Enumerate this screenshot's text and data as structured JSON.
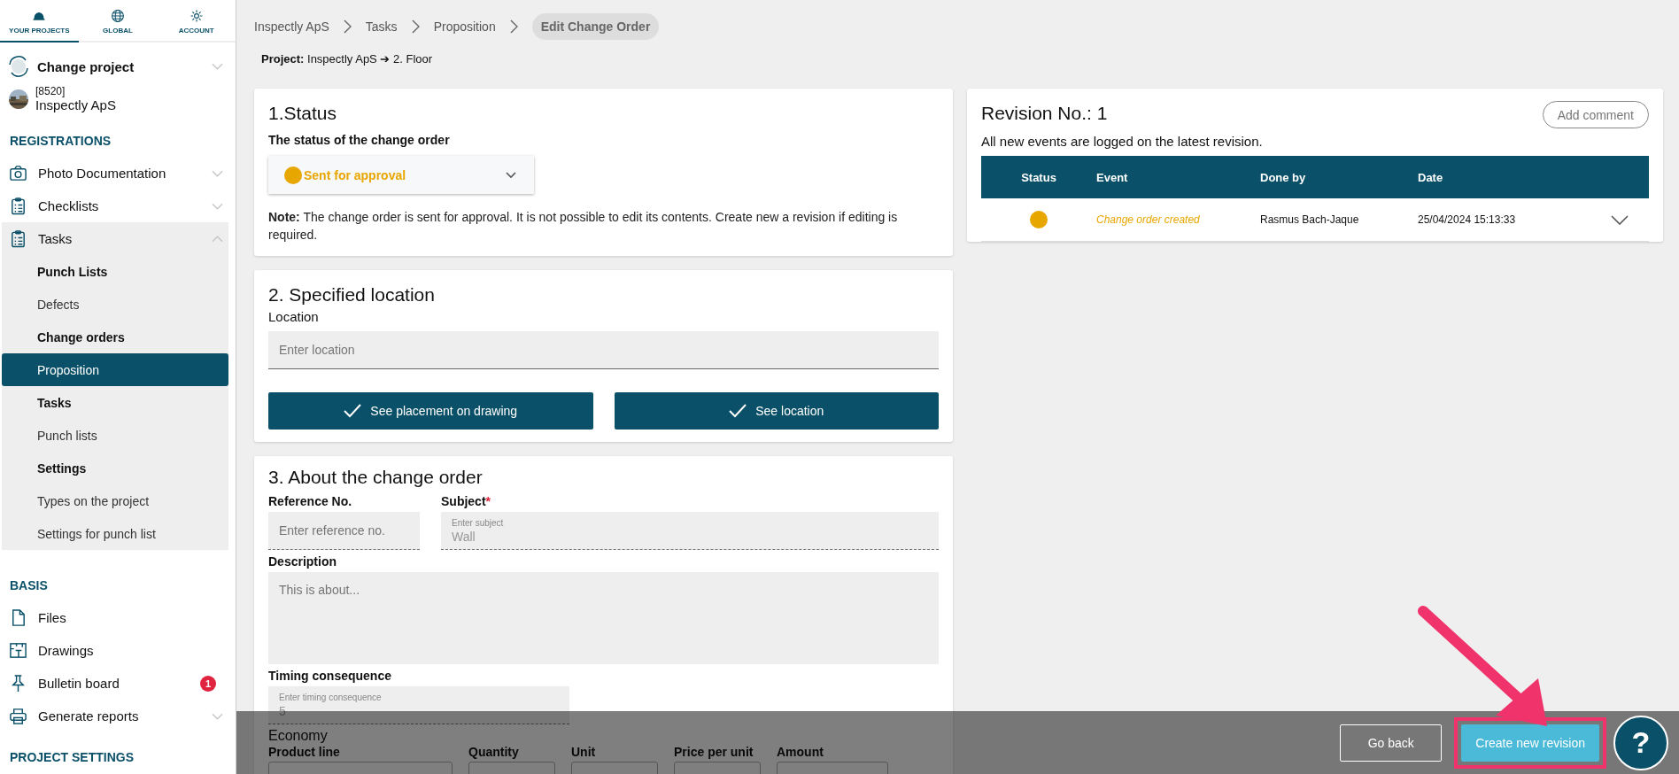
{
  "sidebar": {
    "tabs": [
      {
        "label": "YOUR PROJECTS",
        "selected": true
      },
      {
        "label": "GLOBAL",
        "selected": false
      },
      {
        "label": "ACCOUNT",
        "selected": false
      }
    ],
    "change_project": {
      "label": "Change project",
      "expanded": false
    },
    "project": {
      "number": "[8520]",
      "name": "Inspectly ApS"
    },
    "sections": [
      {
        "title": "REGISTRATIONS",
        "items": [
          {
            "label": "Photo Documentation",
            "expanded": false
          },
          {
            "label": "Checklists",
            "expanded": false
          },
          {
            "label": "Tasks",
            "expanded": true,
            "children": [
              {
                "label": "Punch Lists",
                "kind": "heading",
                "selected": false
              },
              {
                "label": "Defects",
                "kind": "link",
                "selected": false
              },
              {
                "label": "Change orders",
                "kind": "heading",
                "selected": false
              },
              {
                "label": "Proposition",
                "kind": "link",
                "selected": true
              },
              {
                "label": "Tasks",
                "kind": "heading",
                "selected": false
              },
              {
                "label": "Punch lists",
                "kind": "link",
                "selected": false
              },
              {
                "label": "Settings",
                "kind": "heading",
                "selected": false
              },
              {
                "label": "Types on the project",
                "kind": "link",
                "selected": false
              },
              {
                "label": "Settings for punch list",
                "kind": "link",
                "selected": false
              }
            ]
          }
        ]
      },
      {
        "title": "BASIS",
        "items": [
          {
            "label": "Files"
          },
          {
            "label": "Drawings"
          },
          {
            "label": "Bulletin board",
            "badge": "1"
          },
          {
            "label": "Generate reports",
            "expanded": false
          }
        ]
      },
      {
        "title": "PROJECT SETTINGS"
      }
    ]
  },
  "breadcrumb": [
    {
      "label": "Inspectly ApS",
      "selected": false
    },
    {
      "label": "Tasks",
      "selected": false
    },
    {
      "label": "Proposition",
      "selected": false
    },
    {
      "label": "Edit Change Order",
      "selected": true
    }
  ],
  "project_line": "**Project:** Inspectly ApS ➔ 2. Floor",
  "status_card": {
    "title": "1.Status",
    "label": "The status of the change order",
    "status": {
      "value": "Sent for approval",
      "color": "#e8a600"
    },
    "note": "**Note:** The change order is sent for approval. It is not possible to edit its contents. Create new a revision if editing is required."
  },
  "location_card": {
    "title": "2. Specified location",
    "label": "Location",
    "placeholder": "Enter location",
    "buttons": [
      "See placement on drawing",
      "See location"
    ]
  },
  "about_card": {
    "title": "3. About the change order",
    "reference": {
      "label": "Reference No.",
      "placeholder": "Enter reference no."
    },
    "subject": {
      "label": "Subject",
      "required": true,
      "required_mark": "*",
      "placeholder": "Enter subject",
      "value": "Wall"
    },
    "description": {
      "label": "Description",
      "placeholder": "This is about..."
    },
    "timing": {
      "label": "Timing consequence",
      "placeholder": "Enter timing consequence",
      "value": "5"
    },
    "economy": {
      "title": "Economy",
      "columns": [
        "Product line",
        "Quantity",
        "Unit",
        "Price per unit",
        "Amount"
      ]
    }
  },
  "revision": {
    "title": "Revision No.: 1",
    "add_comment": "Add comment",
    "subtitle": "All new events are logged on the latest revision.",
    "columns": [
      "Status",
      "Event",
      "Done by",
      "Date"
    ],
    "rows": [
      {
        "color": "#e8a600",
        "event": "Change order created",
        "done_by": "Rasmus Bach-Jaque",
        "date": "25/04/2024 15:13:33",
        "expanded": false
      }
    ]
  },
  "footer": {
    "go_back": "Go back",
    "create": "Create new revision",
    "create_highlighted": true,
    "help": "?"
  }
}
